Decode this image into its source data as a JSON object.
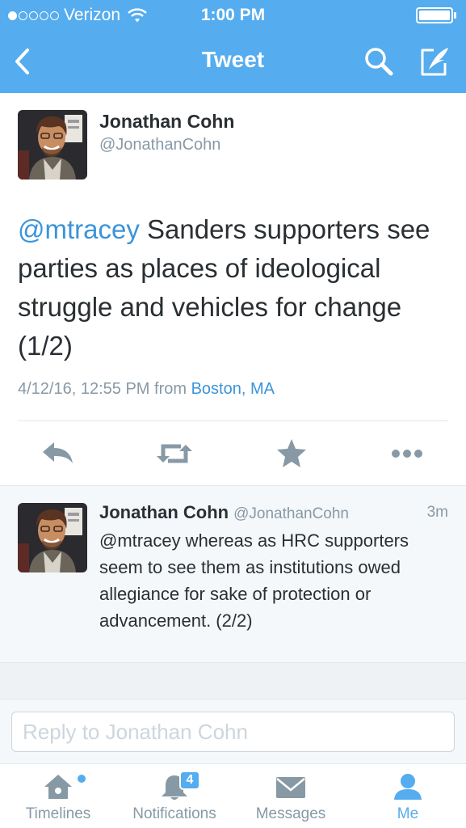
{
  "status_bar": {
    "carrier": "Verizon",
    "time": "1:00 PM"
  },
  "nav": {
    "title": "Tweet",
    "back_icon": "back-chevron-icon",
    "search_icon": "search-icon",
    "compose_icon": "compose-icon"
  },
  "main_tweet": {
    "author_name": "Jonathan Cohn",
    "author_handle": "@JonathanCohn",
    "mention": "@mtracey",
    "text": " Sanders supporters see parties as places of ideological struggle and vehicles for change (1/2)",
    "timestamp": "4/12/16, 12:55 PM",
    "from_label": "from",
    "location": "Boston, MA",
    "actions": [
      "reply-icon",
      "retweet-icon",
      "favorite-icon",
      "more-icon"
    ]
  },
  "reply_tweet": {
    "author_name": "Jonathan Cohn",
    "author_handle": "@JonathanCohn",
    "time": "3m",
    "text": "@mtracey whereas as HRC supporters seem to see them as institutions owed allegiance for sake of protection or advancement. (2/2)"
  },
  "reply_bar": {
    "placeholder": "Reply to Jonathan Cohn"
  },
  "tab_bar": {
    "tabs": [
      {
        "label": "Timelines",
        "icon": "home-icon"
      },
      {
        "label": "Notifications",
        "icon": "bell-icon",
        "badge": "4"
      },
      {
        "label": "Messages",
        "icon": "envelope-icon"
      },
      {
        "label": "Me",
        "icon": "person-icon",
        "active": true
      }
    ]
  },
  "colors": {
    "brand": "#55acee",
    "link": "#3b94d9",
    "text": "#292f33",
    "muted": "#8899a6"
  }
}
